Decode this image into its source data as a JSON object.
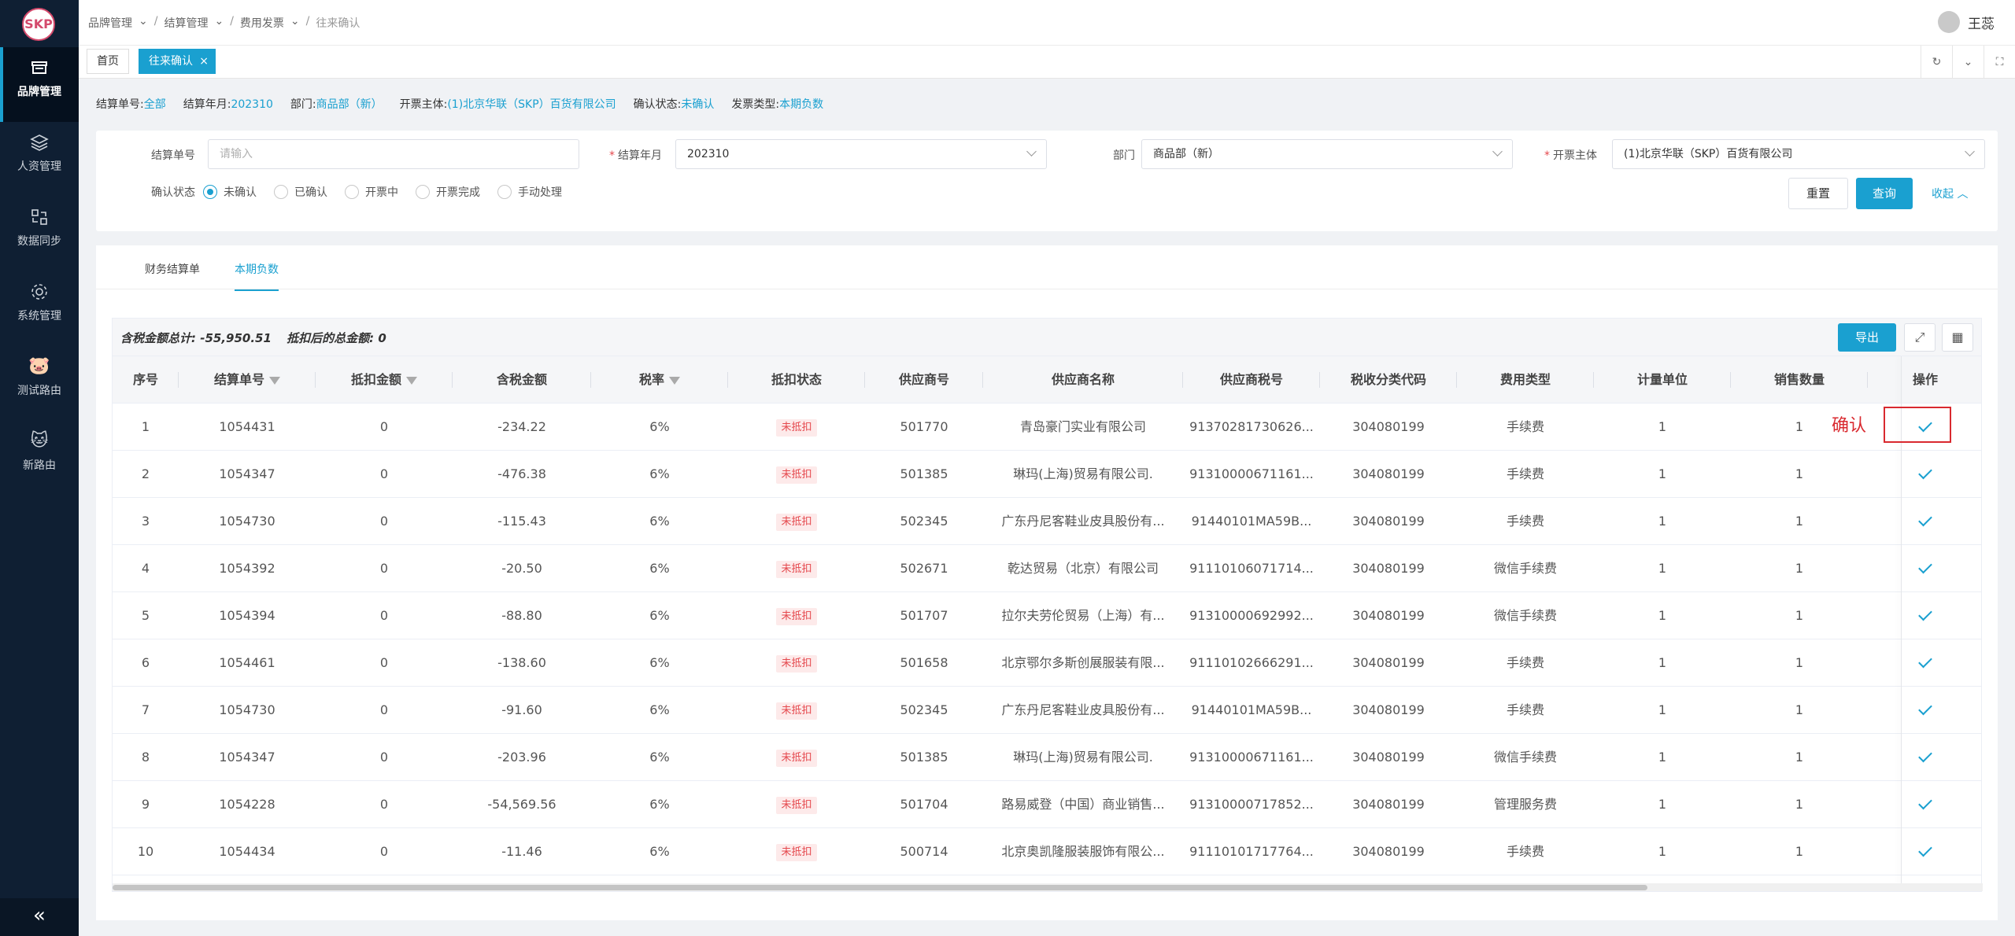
{
  "logo": {
    "text": "SKP"
  },
  "sidebar": {
    "items": [
      {
        "label": "品牌管理",
        "icon": "store-icon"
      },
      {
        "label": "人资管理",
        "icon": "layers-icon"
      },
      {
        "label": "数据同步",
        "icon": "sync-icon"
      },
      {
        "label": "系统管理",
        "icon": "gear-icon"
      },
      {
        "label": "测试路由",
        "icon": "pig-icon"
      },
      {
        "label": "新路由",
        "icon": "cat-icon"
      }
    ],
    "collapse": "«"
  },
  "breadcrumb": [
    "品牌管理",
    "结算管理",
    "费用发票",
    "往来确认"
  ],
  "user": {
    "name": "王蕊"
  },
  "tabs": [
    {
      "label": "首页"
    },
    {
      "label": "往来确认"
    }
  ],
  "summary": [
    {
      "label": "结算单号:",
      "value": "全部"
    },
    {
      "label": "结算年月:",
      "value": "202310"
    },
    {
      "label": "部门:",
      "value": "商品部（新）"
    },
    {
      "label": "开票主体:",
      "value": "(1)北京华联（SKP）百货有限公司"
    },
    {
      "label": "确认状态:",
      "value": "未确认"
    },
    {
      "label": "发票类型:",
      "value": "本期负数"
    }
  ],
  "filters": {
    "settlement_no": {
      "label": "结算单号",
      "placeholder": "请输入"
    },
    "period": {
      "label": "结算年月",
      "value": "202310"
    },
    "dept": {
      "label": "部门",
      "value": "商品部（新）"
    },
    "entity": {
      "label": "开票主体",
      "value": "(1)北京华联（SKP）百货有限公司"
    },
    "status_label": "确认状态",
    "status_options": [
      "未确认",
      "已确认",
      "开票中",
      "开票完成",
      "手动处理"
    ],
    "reset": "重置",
    "query": "查询",
    "collapse": "收起"
  },
  "subtabs": [
    "财务结算单",
    "本期负数"
  ],
  "table": {
    "totals_label1": "含税金额总计: ",
    "totals_value1": "-55,950.51",
    "totals_label2": "抵扣后的总金额: ",
    "totals_value2": "0",
    "export": "导出",
    "columns": [
      "序号",
      "结算单号",
      "抵扣金额",
      "含税金额",
      "税率",
      "抵扣状态",
      "供应商号",
      "供应商名称",
      "供应商税号",
      "税收分类代码",
      "费用类型",
      "计量单位",
      "销售数量",
      "操作"
    ],
    "rows": [
      [
        "1",
        "1054431",
        "0",
        "-234.22",
        "6%",
        "未抵扣",
        "501770",
        "青岛豪门实业有限公司",
        "91370281730626...",
        "304080199",
        "手续费",
        "1",
        "1"
      ],
      [
        "2",
        "1054347",
        "0",
        "-476.38",
        "6%",
        "未抵扣",
        "501385",
        "琳玛(上海)贸易有限公司.",
        "91310000671161...",
        "304080199",
        "手续费",
        "1",
        "1"
      ],
      [
        "3",
        "1054730",
        "0",
        "-115.43",
        "6%",
        "未抵扣",
        "502345",
        "广东丹尼客鞋业皮具股份有...",
        "91440101MA59B...",
        "304080199",
        "手续费",
        "1",
        "1"
      ],
      [
        "4",
        "1054392",
        "0",
        "-20.50",
        "6%",
        "未抵扣",
        "502671",
        "乾达贸易（北京）有限公司",
        "91110106071714...",
        "304080199",
        "微信手续费",
        "1",
        "1"
      ],
      [
        "5",
        "1054394",
        "0",
        "-88.80",
        "6%",
        "未抵扣",
        "501707",
        "拉尔夫劳伦贸易（上海）有...",
        "91310000692992...",
        "304080199",
        "微信手续费",
        "1",
        "1"
      ],
      [
        "6",
        "1054461",
        "0",
        "-138.60",
        "6%",
        "未抵扣",
        "501658",
        "北京鄂尔多斯创展服装有限...",
        "91110102666291...",
        "304080199",
        "手续费",
        "1",
        "1"
      ],
      [
        "7",
        "1054730",
        "0",
        "-91.60",
        "6%",
        "未抵扣",
        "502345",
        "广东丹尼客鞋业皮具股份有...",
        "91440101MA59B...",
        "304080199",
        "手续费",
        "1",
        "1"
      ],
      [
        "8",
        "1054347",
        "0",
        "-203.96",
        "6%",
        "未抵扣",
        "501385",
        "琳玛(上海)贸易有限公司.",
        "91310000671161...",
        "304080199",
        "微信手续费",
        "1",
        "1"
      ],
      [
        "9",
        "1054228",
        "0",
        "-54,569.56",
        "6%",
        "未抵扣",
        "501704",
        "路易威登（中国）商业销售...",
        "91310000717852...",
        "304080199",
        "管理服务费",
        "1",
        "1"
      ],
      [
        "10",
        "1054434",
        "0",
        "-11.46",
        "6%",
        "未抵扣",
        "500714",
        "北京奥凯隆服装服饰有限公...",
        "91110101717764...",
        "304080199",
        "手续费",
        "1",
        "1"
      ]
    ]
  },
  "annotation": "确认",
  "colors": {
    "accent": "#1aa0d0",
    "sidebar": "#0f1f33",
    "danger": "#e5484d"
  }
}
